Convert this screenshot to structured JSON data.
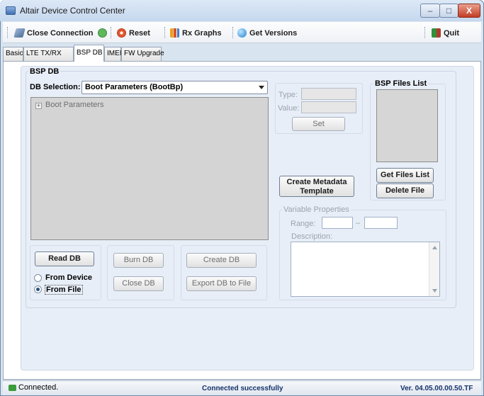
{
  "window": {
    "title": "Altair Device Control Center",
    "minimize_glyph": "–",
    "maximize_glyph": "□",
    "close_glyph": "X"
  },
  "toolbar": {
    "close_connection": "Close Connection",
    "reset": "Reset",
    "rx_graphs": "Rx Graphs",
    "get_versions": "Get Versions",
    "quit": "Quit"
  },
  "tabs": [
    "Basic",
    "LTE TX/RX",
    "BSP DB",
    "IMEI",
    "FW Upgrade"
  ],
  "bsp_db": {
    "group_title": "BSP DB",
    "db_selection_label": "DB Selection:",
    "db_selection_value": "Boot Parameters (BootBp)",
    "tree_root": "Boot Parameters",
    "tree_expander": "+"
  },
  "read": {
    "read_db": "Read DB",
    "from_device": "From Device",
    "from_file": "From File",
    "selected": "From File"
  },
  "db_actions": {
    "burn_db": "Burn DB",
    "close_db": "Close DB",
    "create_db": "Create DB",
    "export_db": "Export DB to File"
  },
  "type_value": {
    "type_label": "Type:",
    "value_label": "Value:",
    "set": "Set"
  },
  "files": {
    "title": "BSP Files List",
    "get_files_list": "Get Files List",
    "delete_file": "Delete File"
  },
  "metadata": {
    "line1": "Create Metadata",
    "line2": "Template"
  },
  "variable_properties": {
    "title": "Variable Properties",
    "range_label": "Range:",
    "range_separator": "–",
    "description_label": "Description:"
  },
  "status": {
    "left": "Connected.",
    "center": "Connected successfully",
    "right": "Ver. 04.05.00.00.50.TF"
  },
  "colors": {
    "accent": "#15326b",
    "window_bg": "#d9e4f1",
    "panel_bg": "#e8eef7"
  },
  "icons": {
    "app": "app-icon",
    "close_connection": "plug-icon",
    "connected_check": "check-icon",
    "reset": "reset-icon",
    "rx_graphs": "bar-chart-icon",
    "get_versions": "globe-icon",
    "quit": "exit-icon",
    "status": "connection-icon"
  }
}
